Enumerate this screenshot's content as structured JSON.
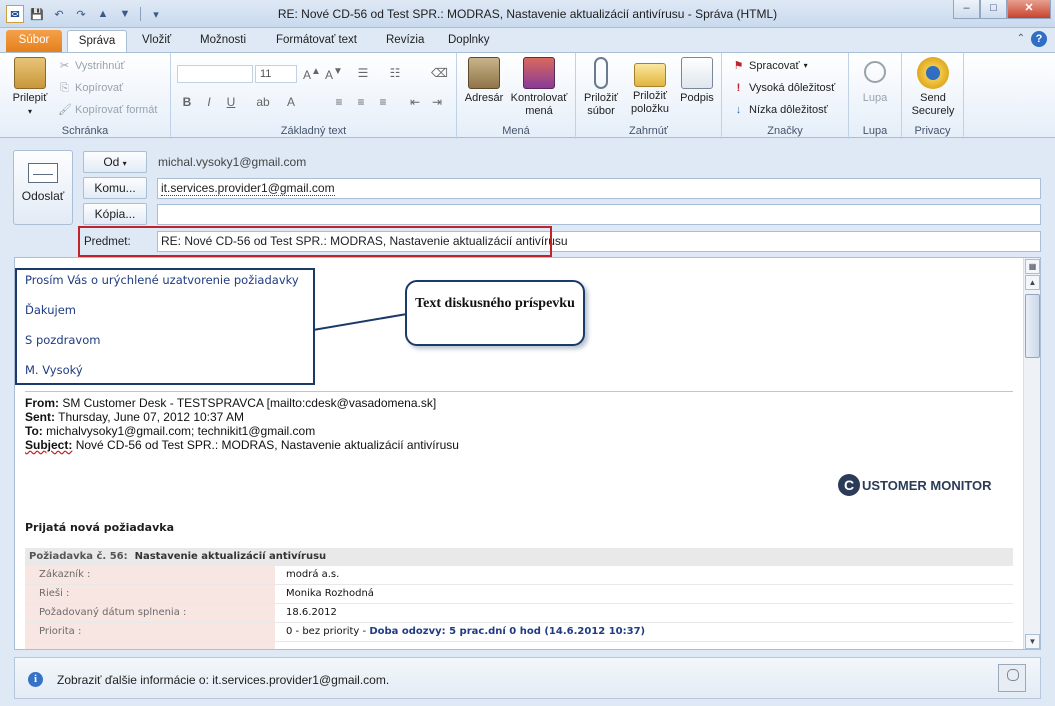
{
  "window": {
    "title": "RE: Nové CD-56 od Test SPR.: MODRAS, Nastavenie aktualizácií  antivírusu  -  Správa (HTML)",
    "minimize": "–",
    "maximize": "□",
    "close": "✕"
  },
  "ribbon_tabs": [
    "Súbor",
    "Správa",
    "Vložiť",
    "Možnosti",
    "Formátovať text",
    "Revízia",
    "Doplnky"
  ],
  "ribbon": {
    "clipboard": {
      "paste": "Prilepiť",
      "cut": "Vystrihnúť",
      "copy": "Kopírovať",
      "format_painter": "Kopírovať formát",
      "label": "Schránka"
    },
    "basic_text": {
      "font_size": "11",
      "bold": "B",
      "italic": "I",
      "underline": "U",
      "label": "Základný text"
    },
    "names": {
      "address_book": "Adresár",
      "check_names_1": "Kontrolovať",
      "check_names_2": "mená",
      "label": "Mená"
    },
    "include": {
      "attach_file_1": "Priložiť",
      "attach_file_2": "súbor",
      "attach_item_1": "Priložiť",
      "attach_item_2": "položku",
      "signature": "Podpis",
      "label": "Zahrnúť"
    },
    "tags": {
      "follow_up": "Spracovať",
      "high_importance": "Vysoká dôležitosť",
      "low_importance": "Nízka dôležitosť",
      "label": "Značky"
    },
    "zoom": {
      "zoom": "Lupa",
      "label": "Lupa"
    },
    "privacy": {
      "send_securely_1": "Send",
      "send_securely_2": "Securely",
      "label": "Privacy"
    }
  },
  "compose": {
    "send": "Odoslať",
    "from_button": "Od",
    "from_value": "michal.vysoky1@gmail.com",
    "to_button": "Komu...",
    "to_value": "it.services.provider1@gmail.com",
    "cc_button": "Kópia...",
    "cc_value": "",
    "subject_label": "Predmet:",
    "subject_value": "RE: Nové CD-56 od Test SPR.: MODRAS, Nastavenie aktualizácií  antivírusu"
  },
  "reply_body": {
    "line1": "Prosím Vás  o urýchlené uzatvorenie požiadavky",
    "line2": "Ďakujem",
    "line3": "S pozdravom",
    "line4": "M. Vysoký",
    "callout": "Text diskusného príspevku"
  },
  "quoted": {
    "from_label": "From:",
    "from_value": "SM Customer Desk - TESTSPRAVCA [mailto:cdesk@vasadomena.sk]",
    "sent_label": "Sent:",
    "sent_value": "Thursday, June 07, 2012 10:37 AM",
    "to_label": "To:",
    "to_value": "michalvysoky1@gmail.com; technikit1@gmail.com",
    "subject_label": "Subject:",
    "subject_value": "Nové CD-56 od Test SPR.: MODRAS, Nastavenie aktualizácií antivírusu",
    "logo_letter": "C",
    "logo_text": "USTOMER MONITOR",
    "new_request": "Prijatá nová požiadavka",
    "request_number": "Požiadavka č. 56:",
    "request_title": "Nastavenie aktualizácií antivírusu",
    "rows": [
      {
        "key": "Zákazník :",
        "value": "modrá a.s."
      },
      {
        "key": "Rieši :",
        "value": "Monika Rozhodná"
      },
      {
        "key": "Požadovaný dátum splnenia :",
        "value": "18.6.2012"
      },
      {
        "key": "Priorita :",
        "value": "0 - bez priority - ",
        "highlight": "Doba odozvy: 5 prac.dní 0 hod (14.6.2012 10:37)"
      }
    ]
  },
  "infobar": {
    "text": "Zobraziť ďalšie informácie o: it.services.provider1@gmail.com."
  },
  "colors": {
    "accent": "#e5801d",
    "link_blue": "#1f3b82",
    "annotation_red": "#c0232a",
    "annotation_navy": "#1b3a68"
  }
}
